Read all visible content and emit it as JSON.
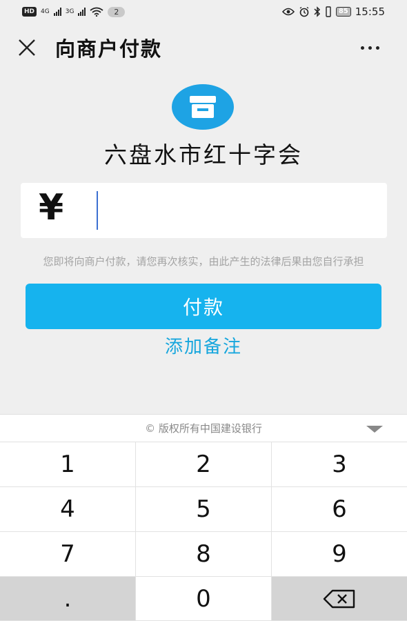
{
  "status_bar": {
    "hd_label": "HD",
    "sim1_net": "4G",
    "sim2_net": "3G",
    "notification_count": "2",
    "battery": "85",
    "time": "15:55"
  },
  "header": {
    "title": "向商户付款"
  },
  "merchant": {
    "name": "六盘水市红十字会"
  },
  "amount": {
    "currency_symbol": "¥",
    "value": ""
  },
  "disclaimer": "您即将向商户付款，请您再次核实，由此产生的法律后果由您自行承担",
  "pay_button_label": "付款",
  "add_note_label": "添加备注",
  "keyboard": {
    "header_text": "© 版权所有中国建设银行",
    "keys": [
      "1",
      "2",
      "3",
      "4",
      "5",
      "6",
      "7",
      "8",
      "9",
      ".",
      "0"
    ]
  },
  "colors": {
    "accent": "#16b3ee",
    "link": "#16a6dd",
    "merchant_icon": "#1ea3e4"
  }
}
